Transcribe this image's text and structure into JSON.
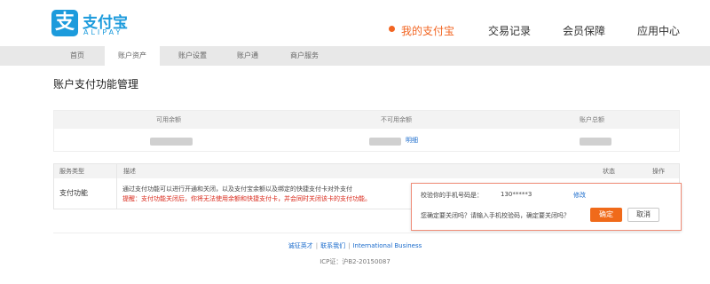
{
  "logo": {
    "cn": "支付宝",
    "en": "ALIPAY",
    "mark": "支"
  },
  "main_nav": [
    {
      "label": "我的支付宝",
      "active": true
    },
    {
      "label": "交易记录"
    },
    {
      "label": "会员保障"
    },
    {
      "label": "应用中心"
    }
  ],
  "subnav": [
    "首页",
    "账户资产",
    "账户设置",
    "账户通",
    "商户服务"
  ],
  "page_title": "账户支付功能管理",
  "summary": {
    "headers": [
      "可用余额",
      "不可用余额",
      "账户总额"
    ],
    "detail_link": "明细"
  },
  "table": {
    "headers": [
      "服务类型",
      "描述",
      "状态",
      "操作"
    ],
    "row_type": "支付功能",
    "desc_line1": "通过支付功能可以进行开通和关闭，以及支付宝余额以及绑定的快捷支付卡对外支付",
    "desc_line2": "提醒：支付功能关闭后，你将无法使用余额和快捷支付卡，并会同时关闭该卡的支付功能。"
  },
  "popup": {
    "line1": "校验你的手机号码是：",
    "phone": "130*****3",
    "modify": "修改",
    "line2": "您确定要关闭吗？请输入手机校验码，确定要关闭吗？",
    "confirm": "确定",
    "cancel": "取消"
  },
  "footer": {
    "links": [
      "诚征英才",
      "联系我们",
      "International Business"
    ],
    "separator": "|",
    "icp": "ICP证：沪B2-20150087"
  },
  "colors": {
    "brand_blue": "#1c9bdc",
    "accent_orange": "#f26522",
    "link": "#1a6bcc",
    "warning_red": "#d9281a"
  }
}
